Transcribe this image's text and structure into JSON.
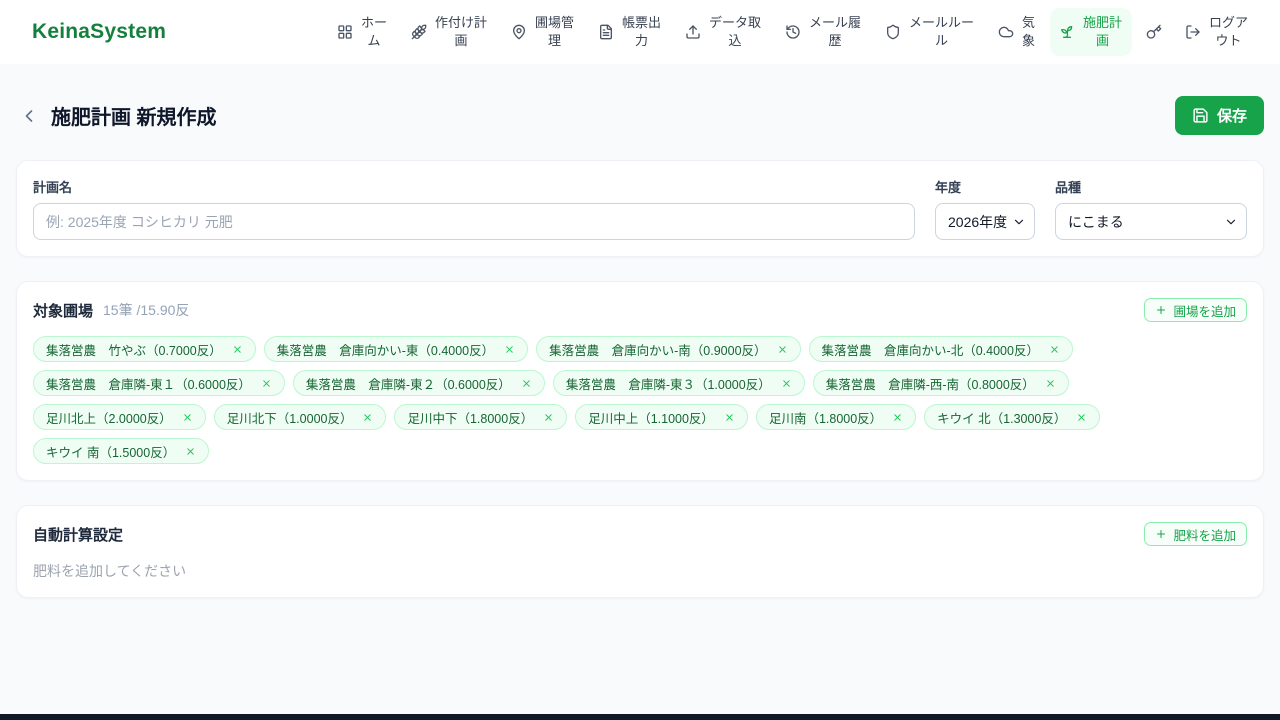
{
  "header": {
    "logo": "KeinaSystem",
    "nav": [
      {
        "icon": "grid-icon",
        "label": "ホーム"
      },
      {
        "icon": "wheat-icon",
        "label": "作付け計画"
      },
      {
        "icon": "map-pin-icon",
        "label": "圃場管理"
      },
      {
        "icon": "document-icon",
        "label": "帳票出力"
      },
      {
        "icon": "upload-icon",
        "label": "データ取込"
      },
      {
        "icon": "history-icon",
        "label": "メール履歴"
      },
      {
        "icon": "shield-icon",
        "label": "メールルール"
      },
      {
        "icon": "cloud-icon",
        "label": "気象"
      },
      {
        "icon": "sprout-icon",
        "label": "施肥計画",
        "active": true
      },
      {
        "icon": "key-icon",
        "label": ""
      },
      {
        "icon": "logout-icon",
        "label": "ログアウト"
      }
    ]
  },
  "page": {
    "title": "施肥計画 新規作成",
    "save_label": "保存"
  },
  "form": {
    "plan_name_label": "計画名",
    "plan_name_placeholder": "例: 2025年度 コシヒカリ 元肥",
    "plan_name_value": "",
    "year_label": "年度",
    "year_value": "2026年度",
    "variety_label": "品種",
    "variety_value": "にこまる"
  },
  "fields_section": {
    "title": "対象圃場",
    "summary": "15筆 /15.90反",
    "add_button_label": "圃場を追加",
    "chips": [
      "集落営農　竹やぶ（0.7000反）",
      "集落営農　倉庫向かい-東（0.4000反）",
      "集落営農　倉庫向かい-南（0.9000反）",
      "集落営農　倉庫向かい-北（0.4000反）",
      "集落営農　倉庫隣-東１（0.6000反）",
      "集落営農　倉庫隣-東２（0.6000反）",
      "集落営農　倉庫隣-東３（1.0000反）",
      "集落営農　倉庫隣-西-南（0.8000反）",
      "足川北上（2.0000反）",
      "足川北下（1.0000反）",
      "足川中下（1.8000反）",
      "足川中上（1.1000反）",
      "足川南（1.8000反）",
      "キウイ 北（1.3000反）",
      "キウイ 南（1.5000反）"
    ]
  },
  "calc_section": {
    "title": "自動計算設定",
    "add_button_label": "肥料を追加",
    "empty_text": "肥料を追加してください"
  },
  "colors": {
    "brand_green": "#15803d",
    "accent_green": "#16a34a",
    "chip_bg": "#f0fdf4",
    "chip_border": "#bbf7d0",
    "chip_text": "#166534",
    "page_bg": "#f8fafc"
  },
  "icons": {
    "grid-icon": "app grid",
    "wheat-icon": "wheat stalk",
    "map-pin-icon": "map pin",
    "document-icon": "file text",
    "upload-icon": "upload arrow tray",
    "history-icon": "clock history",
    "shield-icon": "shield",
    "cloud-icon": "cloud",
    "sprout-icon": "sprout plant",
    "key-icon": "key",
    "logout-icon": "log out",
    "save-icon": "floppy disk",
    "chevron-left-icon": "back chevron",
    "chevron-down-icon": "select chevron",
    "plus-icon": "plus",
    "close-icon": "x"
  }
}
